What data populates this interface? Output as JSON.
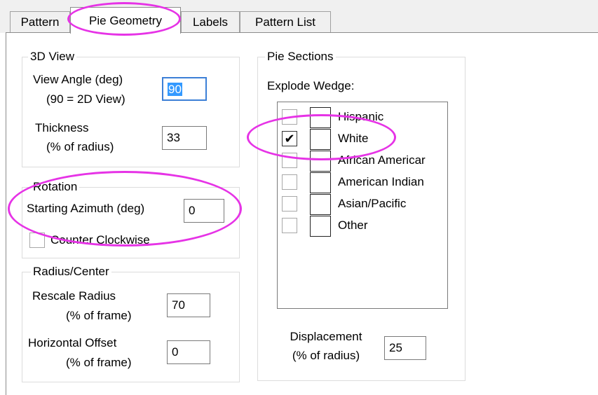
{
  "tabs": [
    {
      "label": "Pattern"
    },
    {
      "label": "Pie Geometry"
    },
    {
      "label": "Labels"
    },
    {
      "label": "Pattern List"
    }
  ],
  "view3d": {
    "title": "3D View",
    "view_angle_label": "View Angle (deg)",
    "view_angle_sub": "(90 = 2D View)",
    "view_angle_value": "90",
    "thickness_label": "Thickness",
    "thickness_sub": "(% of radius)",
    "thickness_value": "33"
  },
  "rotation": {
    "title": "Rotation",
    "azimuth_label": "Starting Azimuth (deg)",
    "azimuth_value": "0",
    "ccw_label": "Counter Clockwise",
    "ccw_checked": false
  },
  "radius": {
    "title": "Radius/Center",
    "rescale_label": "Rescale Radius",
    "rescale_sub": "(% of frame)",
    "rescale_value": "70",
    "offset_label": "Horizontal Offset",
    "offset_sub": "(% of frame)",
    "offset_value": "0"
  },
  "pie_sections": {
    "title": "Pie Sections",
    "explode_label": "Explode Wedge:",
    "wedges": [
      {
        "name": "Hispanic",
        "checked": "",
        "check_glyph": ""
      },
      {
        "name": "White",
        "checked": "true",
        "check_glyph": "✔"
      },
      {
        "name": "African Americar",
        "checked": "",
        "check_glyph": ""
      },
      {
        "name": "American Indian",
        "checked": "",
        "check_glyph": ""
      },
      {
        "name": "Asian/Pacific",
        "checked": "",
        "check_glyph": ""
      },
      {
        "name": "Other",
        "checked": "",
        "check_glyph": ""
      }
    ],
    "displacement_label": "Displacement",
    "displacement_sub": "(% of radius)",
    "displacement_value": "25"
  },
  "colors": {
    "highlight_oval": "#e633e6",
    "selection": "#3399ff"
  }
}
